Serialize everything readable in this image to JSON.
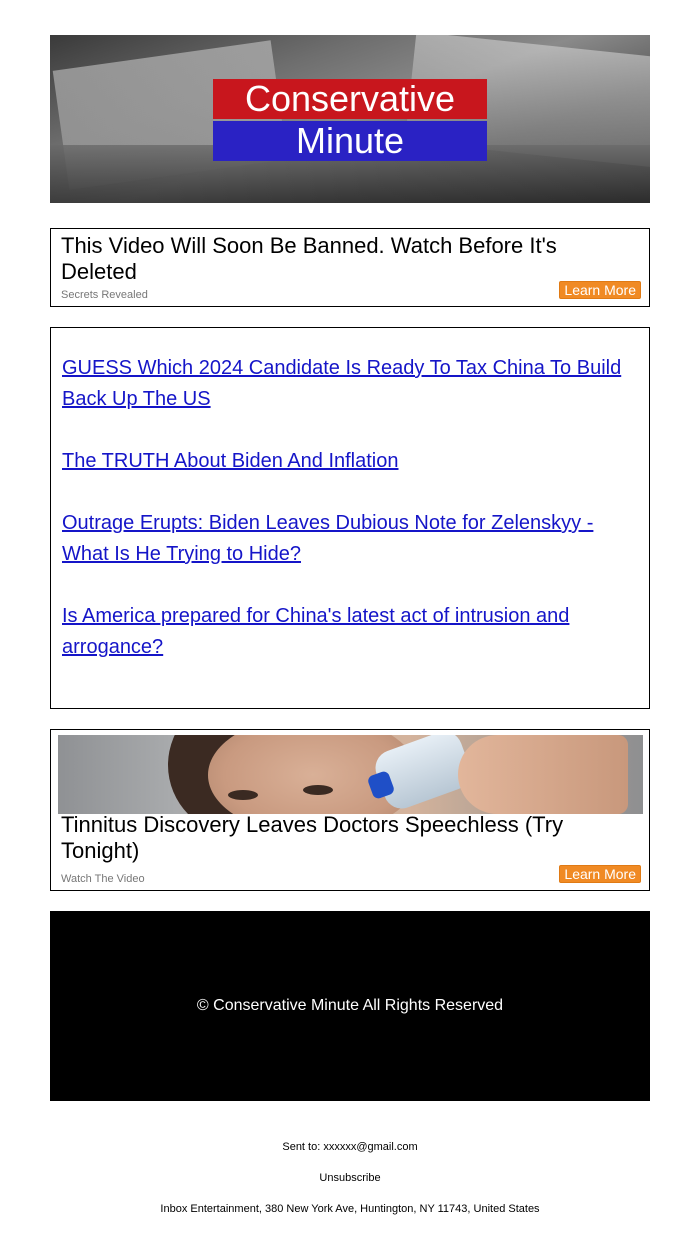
{
  "header": {
    "logo_line1": "Conservative",
    "logo_line2": "Minute",
    "colors": {
      "red": "#c8161d",
      "blue": "#2a22c4"
    }
  },
  "ad_top": {
    "title": "This Video Will Soon Be Banned. Watch Before It's Deleted",
    "sponsor": "Secrets Revealed",
    "button": "Learn More"
  },
  "headlines": [
    "GUESS Which 2024 Candidate Is Ready To Tax China To Build Back Up The US",
    "The TRUTH About Biden And Inflation",
    "Outrage Erupts: Biden Leaves Dubious Note for Zelenskyy - What Is He Trying to Hide?",
    "Is America prepared for China's latest act of intrusion and arrogance?"
  ],
  "ad_bottom": {
    "title": "Tinnitus Discovery Leaves Doctors Speechless (Try Tonight)",
    "sponsor": "Watch The Video",
    "button": "Learn More"
  },
  "footer": {
    "rights": "© Conservative Minute All Rights Reserved",
    "sent_to": "Sent to: xxxxxx@gmail.com",
    "unsubscribe": "Unsubscribe",
    "address": "Inbox Entertainment, 380 New York Ave, Huntington, NY 11743, United States"
  },
  "accent_colors": {
    "button": "#f08a24",
    "link": "#1515c8"
  }
}
